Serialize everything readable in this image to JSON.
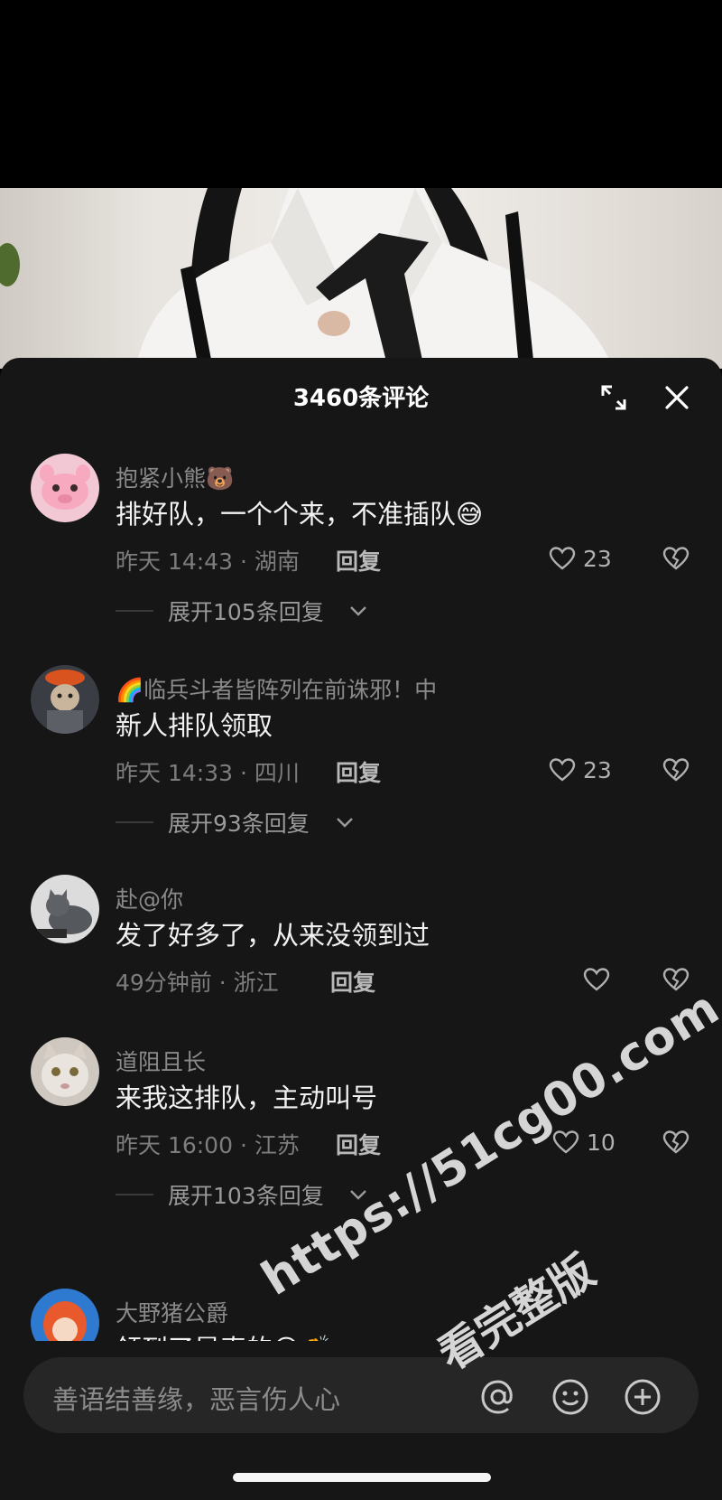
{
  "panel": {
    "title": "3460条评论",
    "expand_icon": "expand-icon",
    "close_icon": "close-icon"
  },
  "comments": [
    {
      "username": "抱紧小熊🐻",
      "text": "排好队，一个个来，不准插队😅",
      "meta": "昨天 14:43 · 湖南",
      "reply": "回复",
      "likes": "23",
      "expand": "展开105条回复"
    },
    {
      "username": "🌈临兵斗者皆阵列在前诛邪！中",
      "text": "新人排队领取",
      "meta": "昨天 14:33 · 四川",
      "reply": "回复",
      "likes": "23",
      "expand": "展开93条回复"
    },
    {
      "username": "赴@你",
      "text": "发了好多了，从来没领到过",
      "meta": "49分钟前 · 浙江",
      "reply": "回复",
      "likes": ""
    },
    {
      "username": "道阻且长",
      "text": "来我这排队，主动叫号",
      "meta": "昨天 16:00 · 江苏",
      "reply": "回复",
      "likes": "10",
      "expand": "展开103条回复"
    },
    {
      "username": "大野猪公爵",
      "text": "领到了是真的😊👏"
    }
  ],
  "input": {
    "placeholder": "善语结善缘，恶言伤人心",
    "icons": [
      "at-icon",
      "emoji-icon",
      "plus-icon"
    ]
  },
  "watermark": {
    "line1": "https://51cg00.com",
    "line2": "看完整版"
  }
}
